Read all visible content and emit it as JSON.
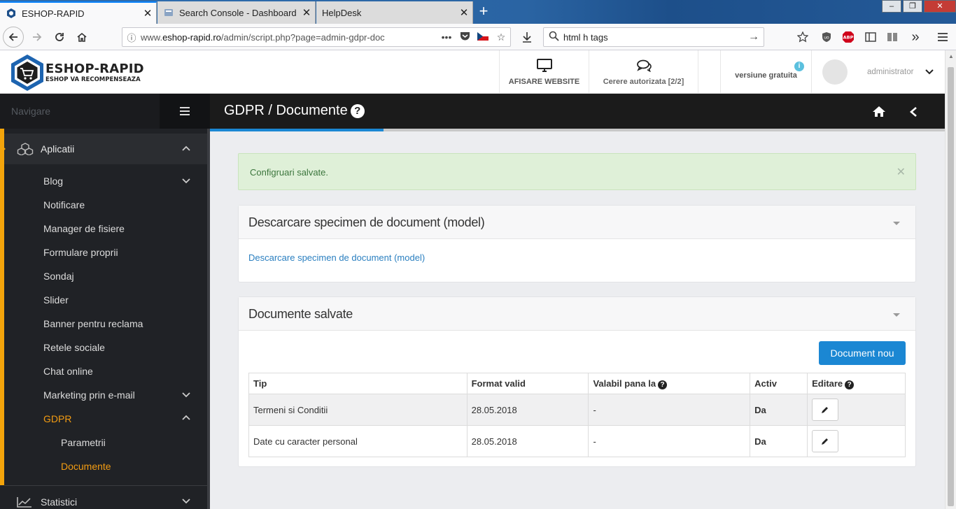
{
  "browser": {
    "tabs": [
      {
        "title": "ESHOP-RAPID",
        "active": true
      },
      {
        "title": "Search Console - Dashboard - I",
        "active": false
      },
      {
        "title": "HelpDesk",
        "active": false
      }
    ],
    "new_tab": "+",
    "url_prefix": "www.",
    "url_domain": "eshop-rapid.ro",
    "url_path": "/admin/script.php?page=admin-gdpr-doc",
    "url_more": "•••",
    "search_value": "html h tags"
  },
  "header": {
    "logo_title": "ESHOP-RAPID",
    "logo_subtitle": "ESHOP VA RECOMPENSEAZA",
    "website_label": "AFISARE WEBSITE",
    "requests_label": "Cerere autorizata [2/2]",
    "version_label": "versiune gratuita",
    "user_name": "administrator"
  },
  "sidebar": {
    "nav_label": "Navigare",
    "main_section": "Aplicatii",
    "items": [
      {
        "label": "Blog",
        "chevron": "down"
      },
      {
        "label": "Notificare"
      },
      {
        "label": "Manager de fisiere"
      },
      {
        "label": "Formulare proprii"
      },
      {
        "label": "Sondaj"
      },
      {
        "label": "Slider"
      },
      {
        "label": "Banner pentru reclama"
      },
      {
        "label": "Retele sociale"
      },
      {
        "label": "Chat online"
      },
      {
        "label": "Marketing prin e-mail",
        "chevron": "down"
      },
      {
        "label": "GDPR",
        "chevron": "up",
        "active": true
      }
    ],
    "sub_items": [
      {
        "label": "Parametrii"
      },
      {
        "label": "Documente",
        "active": true
      }
    ],
    "next_section": "Statistici"
  },
  "page": {
    "title": "GDPR / Documente",
    "alert": "Configruari salvate.",
    "panel1": {
      "title": "Descarcare specimen de document (model)",
      "link": "Descarcare specimen de document (model)"
    },
    "panel2": {
      "title": "Documente salvate",
      "new_button": "Document nou",
      "columns": [
        "Tip",
        "Format valid",
        "Valabil pana la",
        "Activ",
        "Editare"
      ],
      "rows": [
        {
          "tip": "Termeni si Conditii",
          "format": "28.05.2018",
          "valabil": "-",
          "activ": "Da"
        },
        {
          "tip": "Date cu caracter personal",
          "format": "28.05.2018",
          "valabil": "-",
          "activ": "Da"
        }
      ]
    }
  },
  "colors": {
    "accent_orange": "#f39c12",
    "primary_blue": "#1b87d3",
    "sidebar_bg": "#202226",
    "titlebar_bg": "#1b1b1b",
    "alert_bg": "#dff0d8"
  }
}
